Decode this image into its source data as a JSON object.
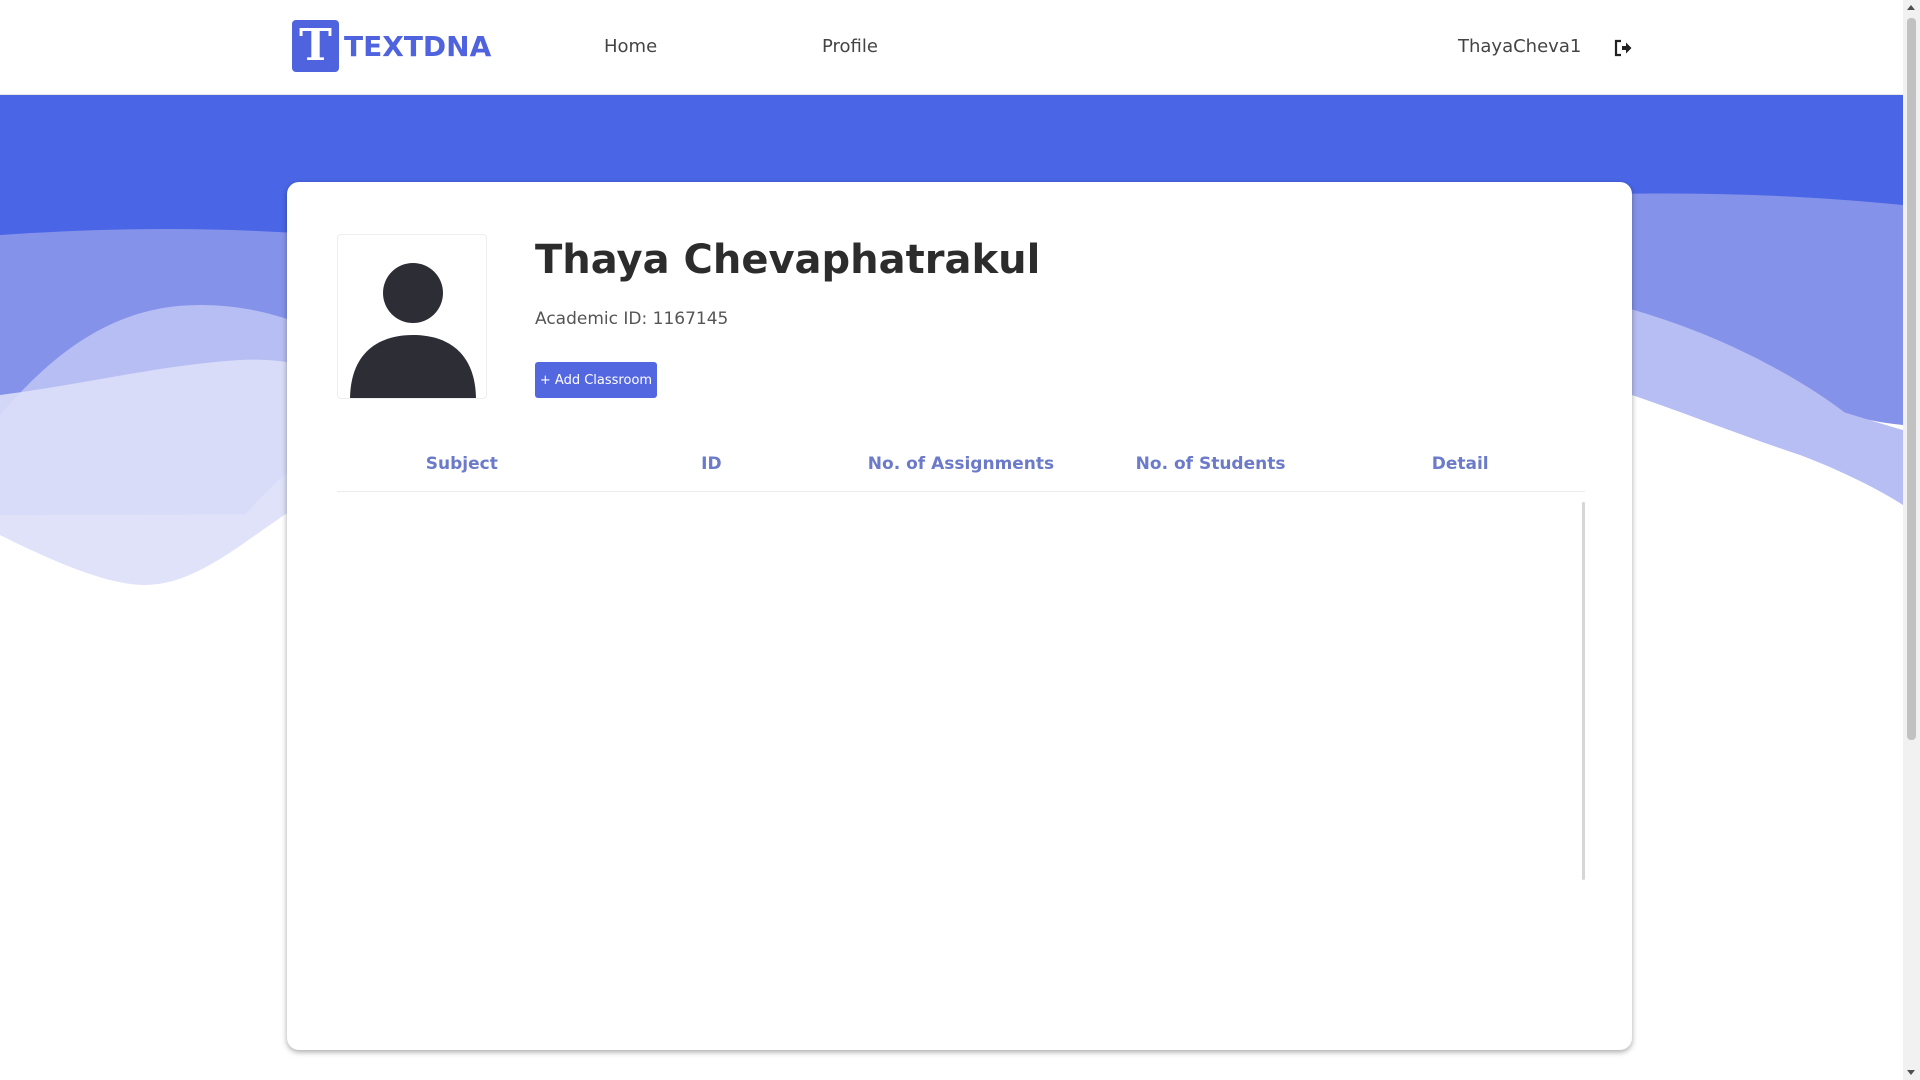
{
  "brand": {
    "logo_letter": "T",
    "name": "TEXTDNA",
    "color": "#4f63de"
  },
  "nav": {
    "home": "Home",
    "profile": "Profile",
    "username": "ThayaCheva1",
    "logout_icon": "sign-out-icon"
  },
  "profile": {
    "name": "Thaya Chevaphatrakul",
    "academic_id_label": "Academic ID:",
    "academic_id": "1167145",
    "add_classroom_label": "+ Add Classroom",
    "avatar_icon": "user-silhouette-icon"
  },
  "table": {
    "columns": [
      "Subject",
      "ID",
      "No. of Assignments",
      "No. of Students",
      "Detail"
    ],
    "rows": []
  },
  "colors": {
    "banner_blue": "#4a66e6",
    "wave_mid": "#a8b2ee",
    "wave_light": "#dcdff8",
    "header_text": "#6b7ac9",
    "button": "#5367e0"
  }
}
